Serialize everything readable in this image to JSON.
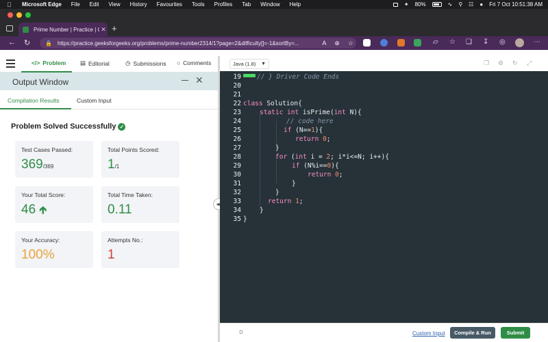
{
  "menubar": {
    "app": "Microsoft Edge",
    "items": [
      "File",
      "Edit",
      "View",
      "History",
      "Favourites",
      "Tools",
      "Profiles",
      "Tab",
      "Window",
      "Help"
    ],
    "battery": "80%",
    "battery_level": 0.8,
    "datetime": "Fri 7 Oct  10:51:38 AM"
  },
  "browser": {
    "tab_title": "Prime Number | Practice | Geek",
    "url": "https://practice.geeksforgeeks.org/problems/prime-number2314/1?page=2&difficulty[]=-1&sortBy=..."
  },
  "colors": {
    "accent": "#2f8d46",
    "editor_bg": "#263238",
    "browser_purple": "#4a2a58",
    "value_green": "#2f8d46",
    "value_orange": "#e8a33a",
    "value_red": "#d63c3c"
  },
  "gfg": {
    "tabs": [
      {
        "label": "Problem",
        "icon": "code-icon"
      },
      {
        "label": "Editorial",
        "icon": "document-icon"
      },
      {
        "label": "Submissions",
        "icon": "clock-icon"
      },
      {
        "label": "Comments",
        "icon": "chat-icon"
      }
    ]
  },
  "output": {
    "title": "Output Window",
    "subtabs": [
      "Compilation Results",
      "Custom Input"
    ],
    "status": "Problem Solved Successfully",
    "cards": {
      "test_cases": {
        "label": "Test Cases Passed:",
        "value": "369",
        "sub": "/369"
      },
      "total_points": {
        "label": "Total Points Scored:",
        "value": "1",
        "sub": "/1"
      },
      "total_score": {
        "label": "Your Total Score:",
        "value": "46",
        "trend": "up-arrow-icon"
      },
      "time_taken": {
        "label": "Total Time Taken:",
        "value": "0.11"
      },
      "accuracy": {
        "label": "Your Accuracy:",
        "value": "100%"
      },
      "attempts": {
        "label": "Attempts No.:",
        "value": "1"
      }
    }
  },
  "editor": {
    "language": "Java (1.8)",
    "code": {
      "l19": "// } Driver Code Ends",
      "l22a": "class",
      "l22b": " Solution{",
      "l23a": "static int",
      "l23b": " isPrime(",
      "l23c": "int",
      "l23d": " N){",
      "l24": "// code here",
      "l25a": "if",
      "l25b": " (N==",
      "l25c": "1",
      "l25d": "){",
      "l26a": "return",
      "l26b": "0",
      "l26c": ";",
      "l27": "}",
      "l28a": "for",
      "l28b": " (",
      "l28c": "int",
      "l28d": " i = ",
      "l28e": "2",
      "l28f": "; i*i<=N; i++){",
      "l29a": "if",
      "l29b": " (N%i==",
      "l29c": "0",
      "l29d": "){",
      "l30a": "return",
      "l30b": "0",
      "l30c": ";",
      "l31": "}",
      "l32": "}",
      "l33a": "return",
      "l33b": "1",
      "l33c": ";",
      "l34": "}",
      "l35": "}"
    },
    "line_numbers": [
      "19",
      "20",
      "21",
      "22",
      "23",
      "24",
      "25",
      "26",
      "27",
      "28",
      "29",
      "30",
      "31",
      "32",
      "33",
      "34",
      "35"
    ]
  },
  "footer": {
    "custom_input": "Custom Input",
    "compile_run": "Compile & Run",
    "submit": "Submit"
  }
}
